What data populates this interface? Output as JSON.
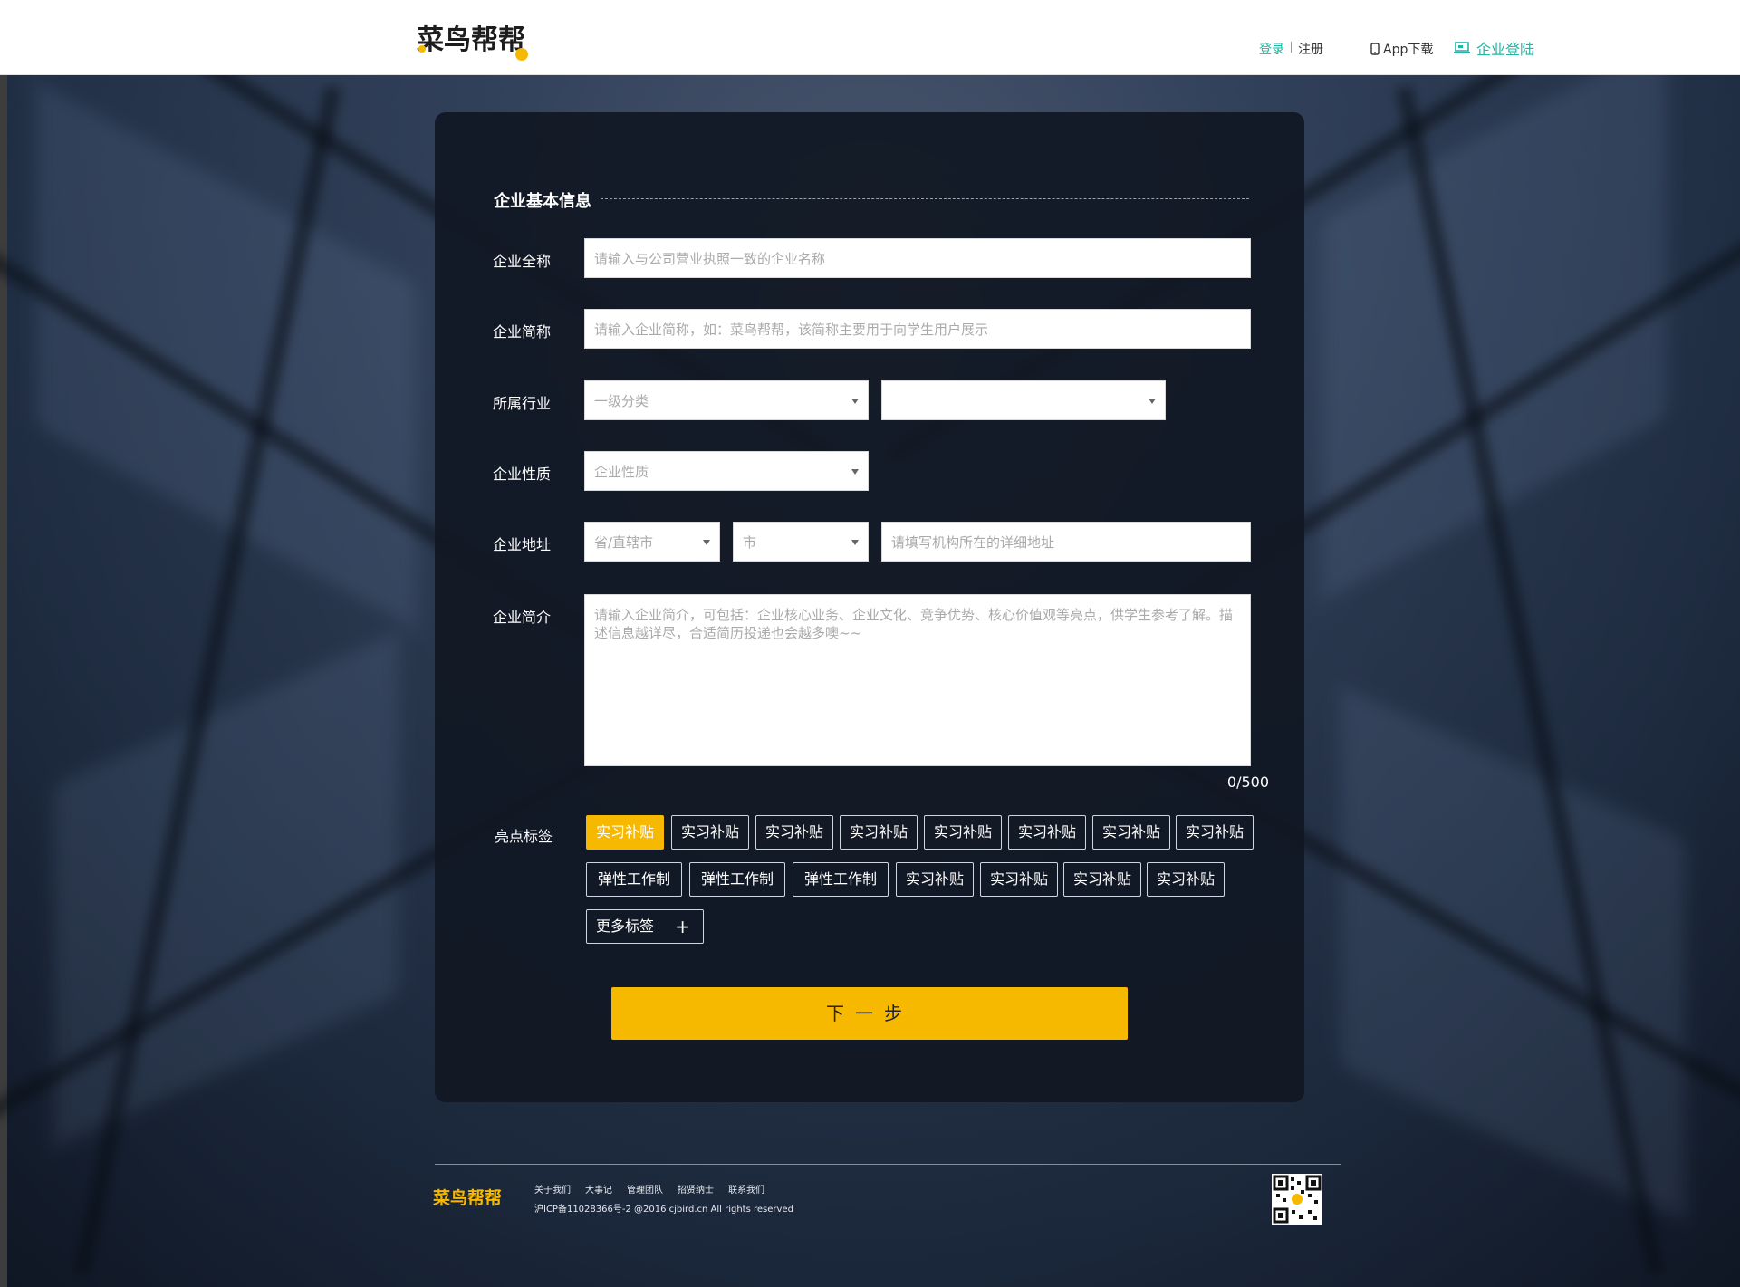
{
  "header": {
    "logo_text": "菜鸟帮帮",
    "login": "登录",
    "register": "注册",
    "app_download": "App下载",
    "enterprise_login": "企业登陆",
    "accent_color": "#1eb7a6"
  },
  "form": {
    "section_title": "企业基本信息",
    "full_name": {
      "label": "企业全称",
      "placeholder": "请输入与公司营业执照一致的企业名称"
    },
    "short_name": {
      "label": "企业简称",
      "placeholder": "请输入企业简称，如：菜鸟帮帮，该简称主要用于向学生用户展示"
    },
    "industry": {
      "label": "所属行业",
      "primary": "一级分类",
      "secondary": ""
    },
    "nature": {
      "label": "企业性质",
      "value": "企业性质"
    },
    "address": {
      "label": "企业地址",
      "province": "省/直辖市",
      "city": "市",
      "detail_placeholder": "请填写机构所在的详细地址"
    },
    "intro": {
      "label": "企业简介",
      "placeholder": "请输入企业简介，可包括：企业核心业务、企业文化、竞争优势、核心价值观等亮点，供学生参考了解。描述信息越详尽，合适简历投递也会越多噢~~",
      "counter": "0/500"
    },
    "highlights": {
      "label": "亮点标签",
      "row1": [
        "实习补贴",
        "实习补贴",
        "实习补贴",
        "实习补贴",
        "实习补贴",
        "实习补贴",
        "实习补贴",
        "实习补贴"
      ],
      "row2": [
        "弹性工作制",
        "弹性工作制",
        "弹性工作制",
        "实习补贴",
        "实习补贴",
        "实习补贴",
        "实习补贴"
      ],
      "more": "更多标签",
      "more_icon": "+"
    },
    "next_button": "下一步",
    "primary_color": "#f7b800"
  },
  "footer": {
    "logo_text": "菜鸟帮帮",
    "links": [
      "关于我们",
      "大事记",
      "管理团队",
      "招贤纳士",
      "联系我们"
    ],
    "copyright": "沪ICP备11028366号-2 @2016 cjbird.cn All rights reserved"
  }
}
